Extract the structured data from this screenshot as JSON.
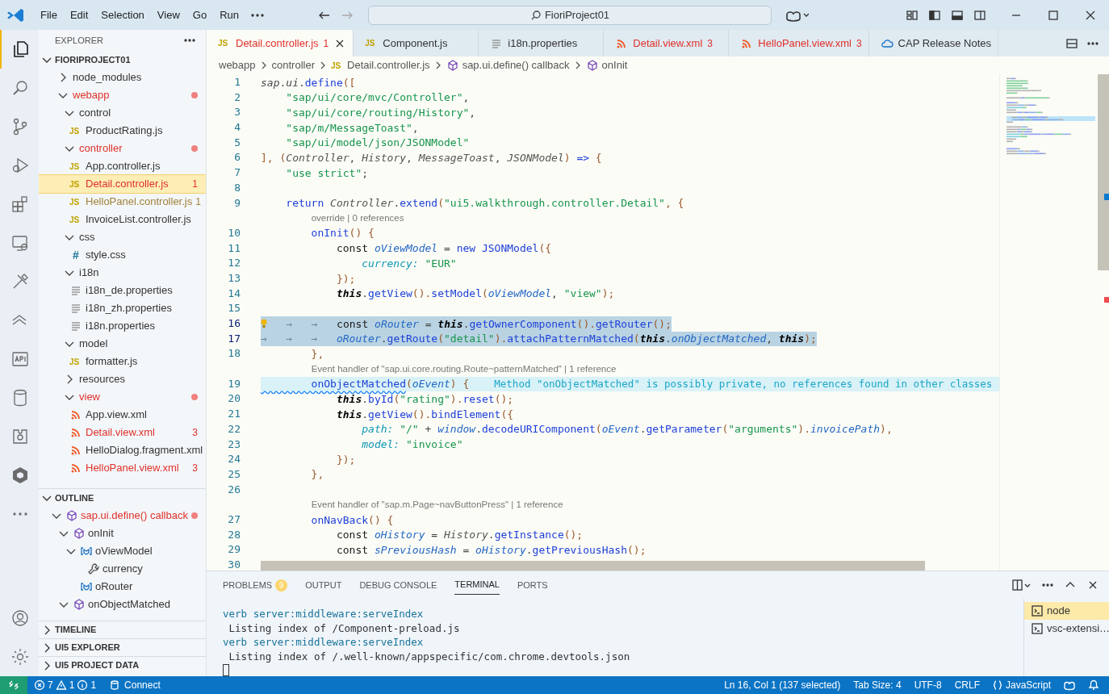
{
  "title_bar": {
    "menus": [
      "File",
      "Edit",
      "Selection",
      "View",
      "Go",
      "Run"
    ],
    "search": "FioriProject01"
  },
  "activity_bar": {
    "items": [
      {
        "kind": "files",
        "selected": true
      },
      {
        "kind": "search",
        "selected": false
      },
      {
        "kind": "source-control",
        "selected": false
      },
      {
        "kind": "debug",
        "selected": false
      },
      {
        "kind": "extensions",
        "selected": false
      },
      {
        "kind": "remote",
        "selected": false
      },
      {
        "kind": "tools",
        "selected": false
      },
      {
        "kind": "layers",
        "selected": false
      },
      {
        "kind": "api",
        "selected": false
      },
      {
        "kind": "database",
        "selected": false
      },
      {
        "kind": "puzzle",
        "selected": false
      },
      {
        "kind": "hexagon",
        "selected": false
      },
      {
        "kind": "more",
        "selected": false
      }
    ],
    "bottom": [
      {
        "kind": "account"
      },
      {
        "kind": "settings"
      }
    ]
  },
  "explorer": {
    "title": "EXPLORER",
    "root": "FIORIPROJECT01",
    "items": [
      {
        "label": "node_modules",
        "kind": "folder",
        "expanded": false,
        "error": false,
        "warning": false,
        "selected": false
      },
      {
        "label": "webapp",
        "kind": "folder",
        "expanded": true,
        "error": true,
        "warning": false,
        "selected": false,
        "children": [
          {
            "label": "control",
            "kind": "folder",
            "expanded": true,
            "error": false,
            "warning": false,
            "selected": false,
            "children": [
              {
                "label": "ProductRating.js",
                "kind": "js",
                "icon_text": "JS",
                "error": false,
                "warning": false,
                "selected": false
              }
            ]
          },
          {
            "label": "controller",
            "kind": "folder",
            "expanded": true,
            "error": true,
            "warning": false,
            "selected": false,
            "children": [
              {
                "label": "App.controller.js",
                "kind": "js",
                "icon_text": "JS",
                "error": false,
                "warning": false,
                "selected": false
              },
              {
                "label": "Detail.controller.js",
                "kind": "js",
                "icon_text": "JS",
                "error": true,
                "warning": false,
                "badge": "1",
                "selected": true
              },
              {
                "label": "HelloPanel.controller.js",
                "kind": "js",
                "icon_text": "JS",
                "error": false,
                "warning": true,
                "badge": "1",
                "selected": false
              },
              {
                "label": "InvoiceList.controller.js",
                "kind": "js",
                "icon_text": "JS",
                "error": false,
                "warning": false,
                "selected": false
              }
            ]
          },
          {
            "label": "css",
            "kind": "folder",
            "expanded": true,
            "error": false,
            "warning": false,
            "selected": false,
            "children": [
              {
                "label": "style.css",
                "kind": "css",
                "icon_text": "#",
                "error": false,
                "warning": false,
                "selected": false
              }
            ]
          },
          {
            "label": "i18n",
            "kind": "folder",
            "expanded": true,
            "error": false,
            "warning": false,
            "selected": false,
            "children": [
              {
                "label": "i18n_de.properties",
                "kind": "props",
                "error": false,
                "warning": false,
                "selected": false
              },
              {
                "label": "i18n_zh.properties",
                "kind": "props",
                "error": false,
                "warning": false,
                "selected": false
              },
              {
                "label": "i18n.properties",
                "kind": "props",
                "error": false,
                "warning": false,
                "selected": false
              }
            ]
          },
          {
            "label": "model",
            "kind": "folder",
            "expanded": true,
            "error": false,
            "warning": false,
            "selected": false,
            "children": [
              {
                "label": "formatter.js",
                "kind": "js",
                "icon_text": "JS",
                "error": false,
                "warning": false,
                "selected": false
              }
            ]
          },
          {
            "label": "resources",
            "kind": "folder",
            "expanded": false,
            "error": false,
            "warning": false,
            "selected": false
          },
          {
            "label": "view",
            "kind": "folder",
            "expanded": true,
            "error": true,
            "warning": false,
            "selected": false,
            "children": [
              {
                "label": "App.view.xml",
                "kind": "xml",
                "error": false,
                "warning": false,
                "selected": false
              },
              {
                "label": "Detail.view.xml",
                "kind": "xml",
                "error": true,
                "warning": false,
                "badge": "3",
                "selected": false
              },
              {
                "label": "HelloDialog.fragment.xml",
                "kind": "xml",
                "error": false,
                "warning": false,
                "selected": false
              },
              {
                "label": "HelloPanel.view.xml",
                "kind": "xml",
                "error": true,
                "warning": false,
                "badge": "3",
                "selected": false
              }
            ]
          }
        ]
      }
    ]
  },
  "outline": {
    "title": "OUTLINE",
    "items": [
      {
        "label": "sap.ui.define() callback",
        "kind": "method",
        "expanded": true,
        "error": true,
        "children": [
          {
            "label": "onInit",
            "kind": "method",
            "expanded": true,
            "error": false,
            "children": [
              {
                "label": "oViewModel",
                "kind": "variable",
                "expanded": true,
                "error": false,
                "children": [
                  {
                    "label": "currency",
                    "kind": "property",
                    "error": false
                  }
                ]
              },
              {
                "label": "oRouter",
                "kind": "variable",
                "error": false
              }
            ]
          },
          {
            "label": "onObjectMatched",
            "kind": "method",
            "expanded": true,
            "error": false
          }
        ]
      }
    ]
  },
  "collapsed_sections": [
    "TIMELINE",
    "UI5 EXPLORER",
    "UI5 PROJECT DATA"
  ],
  "tabs": [
    {
      "label": "Detail.controller.js",
      "kind": "js",
      "icon_text": "JS",
      "error": true,
      "badge": "1",
      "selected": true
    },
    {
      "label": "Component.js",
      "kind": "js",
      "icon_text": "JS",
      "error": false,
      "selected": false
    },
    {
      "label": "i18n.properties",
      "kind": "props",
      "error": false,
      "selected": false
    },
    {
      "label": "Detail.view.xml",
      "kind": "xml",
      "error": true,
      "badge": "3",
      "selected": false
    },
    {
      "label": "HelloPanel.view.xml",
      "kind": "xml",
      "error": true,
      "badge": "3",
      "selected": false
    },
    {
      "label": "CAP Release Notes",
      "kind": "cloud",
      "error": false,
      "selected": false
    }
  ],
  "breadcrumbs": [
    {
      "label": "webapp",
      "kind": "folder"
    },
    {
      "label": "controller",
      "kind": "folder"
    },
    {
      "label": "Detail.controller.js",
      "kind": "js",
      "icon_text": "JS"
    },
    {
      "label": "sap.ui.define() callback",
      "kind": "method"
    },
    {
      "label": "onInit",
      "kind": "method"
    }
  ],
  "editor": {
    "lines": [
      {
        "kind": "code",
        "number": "1",
        "selected": false,
        "highlighted": false,
        "tokens": [
          {
            "text": "sap",
            "kind": "id"
          },
          {
            "text": ".",
            "kind": "p"
          },
          {
            "text": "ui",
            "kind": "id"
          },
          {
            "text": ".",
            "kind": "p"
          },
          {
            "text": "define",
            "kind": "fn"
          },
          {
            "text": "([",
            "kind": "br"
          }
        ]
      },
      {
        "kind": "code",
        "number": "2",
        "selected": false,
        "highlighted": false,
        "tokens": [
          {
            "text": "    \"sap/ui/core/mvc/Controller\"",
            "kind": "str"
          },
          {
            "text": ",",
            "kind": "p"
          }
        ]
      },
      {
        "kind": "code",
        "number": "3",
        "selected": false,
        "highlighted": false,
        "tokens": [
          {
            "text": "    \"sap/ui/core/routing/History\"",
            "kind": "str"
          },
          {
            "text": ",",
            "kind": "p"
          }
        ]
      },
      {
        "kind": "code",
        "number": "4",
        "selected": false,
        "highlighted": false,
        "tokens": [
          {
            "text": "    \"sap/m/MessageToast\"",
            "kind": "str"
          },
          {
            "text": ",",
            "kind": "p"
          }
        ]
      },
      {
        "kind": "code",
        "number": "5",
        "selected": false,
        "highlighted": false,
        "tokens": [
          {
            "text": "    \"sap/ui/model/json/JSONModel\"",
            "kind": "str"
          }
        ]
      },
      {
        "kind": "code",
        "number": "6",
        "selected": false,
        "highlighted": false,
        "tokens": [
          {
            "text": "], (",
            "kind": "br"
          },
          {
            "text": "Controller",
            "kind": "cls"
          },
          {
            "text": ",",
            "kind": "p"
          },
          {
            "text": " History",
            "kind": "cls"
          },
          {
            "text": ",",
            "kind": "p"
          },
          {
            "text": " MessageToast",
            "kind": "cls"
          },
          {
            "text": ",",
            "kind": "p"
          },
          {
            "text": " JSONModel",
            "kind": "cls"
          },
          {
            "text": ")",
            "kind": "br"
          },
          {
            "text": " =>",
            "kind": "kwb"
          },
          {
            "text": " {",
            "kind": "br"
          }
        ]
      },
      {
        "kind": "code",
        "number": "7",
        "selected": false,
        "highlighted": false,
        "tokens": [
          {
            "text": "    \"use strict\"",
            "kind": "str"
          },
          {
            "text": ";",
            "kind": "p"
          }
        ]
      },
      {
        "kind": "code",
        "number": "8",
        "selected": false,
        "highlighted": false
      },
      {
        "kind": "code",
        "number": "9",
        "selected": false,
        "highlighted": false,
        "tokens": [
          {
            "text": "    return",
            "kind": "kwb"
          },
          {
            "text": " Controller",
            "kind": "cls"
          },
          {
            "text": ".",
            "kind": "p"
          },
          {
            "text": "extend",
            "kind": "fn"
          },
          {
            "text": "(",
            "kind": "br"
          },
          {
            "text": "\"ui5.walkthrough.controller.Detail\"",
            "kind": "str"
          },
          {
            "text": ", {",
            "kind": "br"
          }
        ]
      },
      {
        "kind": "lens",
        "text": "override | 0 references"
      },
      {
        "kind": "code",
        "number": "10",
        "selected": false,
        "highlighted": false,
        "tokens": [
          {
            "text": "        onInit",
            "kind": "fn"
          },
          {
            "text": "() {",
            "kind": "br"
          }
        ]
      },
      {
        "kind": "code",
        "number": "11",
        "selected": false,
        "highlighted": false,
        "tokens": [
          {
            "text": "            const",
            "kind": "kw"
          },
          {
            "text": " oViewModel",
            "kind": "var"
          },
          {
            "text": " =",
            "kind": "p"
          },
          {
            "text": " new",
            "kind": "kwb"
          },
          {
            "text": " JSONModel",
            "kind": "fn"
          },
          {
            "text": "({",
            "kind": "br"
          }
        ]
      },
      {
        "kind": "code",
        "number": "12",
        "selected": false,
        "highlighted": false,
        "tokens": [
          {
            "text": "                currency:",
            "kind": "prop"
          },
          {
            "text": " \"EUR\"",
            "kind": "str"
          }
        ]
      },
      {
        "kind": "code",
        "number": "13",
        "selected": false,
        "highlighted": false,
        "tokens": [
          {
            "text": "            });",
            "kind": "br"
          }
        ]
      },
      {
        "kind": "code",
        "number": "14",
        "selected": false,
        "highlighted": false,
        "tokens": [
          {
            "text": "            this",
            "kind": "this"
          },
          {
            "text": ".",
            "kind": "p"
          },
          {
            "text": "getView",
            "kind": "fn"
          },
          {
            "text": "().",
            "kind": "br"
          },
          {
            "text": "setModel",
            "kind": "fn"
          },
          {
            "text": "(",
            "kind": "br"
          },
          {
            "text": "oViewModel",
            "kind": "var"
          },
          {
            "text": ",",
            "kind": "p"
          },
          {
            "text": " \"view\"",
            "kind": "str"
          },
          {
            "text": ");",
            "kind": "br"
          }
        ]
      },
      {
        "kind": "code",
        "number": "15",
        "selected": false,
        "highlighted": false
      },
      {
        "kind": "code",
        "number": "16",
        "selected": true,
        "highlighted": false,
        "tokens": [
          {
            "kind": "bulb"
          },
          {
            "text": "   →   →",
            "kind": "ws"
          },
          {
            "text": "   const",
            "kind": "kw"
          },
          {
            "text": " oRouter",
            "kind": "var"
          },
          {
            "text": " =",
            "kind": "p"
          },
          {
            "text": " this",
            "kind": "this"
          },
          {
            "text": ".",
            "kind": "p"
          },
          {
            "text": "getOwnerComponent",
            "kind": "fn"
          },
          {
            "text": "().",
            "kind": "br"
          },
          {
            "text": "getRouter",
            "kind": "fn"
          },
          {
            "text": "();",
            "kind": "br"
          }
        ]
      },
      {
        "kind": "code",
        "number": "17",
        "selected": true,
        "highlighted": false,
        "tokens": [
          {
            "text": "→   →   →",
            "kind": "ws"
          },
          {
            "text": "   oRouter",
            "kind": "var"
          },
          {
            "text": ".",
            "kind": "p"
          },
          {
            "text": "getRoute",
            "kind": "fn"
          },
          {
            "text": "(",
            "kind": "br"
          },
          {
            "text": "\"detail\"",
            "kind": "str"
          },
          {
            "text": ").",
            "kind": "br"
          },
          {
            "text": "attachPatternMatched",
            "kind": "fn"
          },
          {
            "text": "(",
            "kind": "br"
          },
          {
            "text": "this",
            "kind": "this"
          },
          {
            "text": ".",
            "kind": "p"
          },
          {
            "text": "onObjectMatched",
            "kind": "var"
          },
          {
            "text": ",",
            "kind": "p"
          },
          {
            "text": " this",
            "kind": "this"
          },
          {
            "text": ");",
            "kind": "br"
          }
        ]
      },
      {
        "kind": "code",
        "number": "18",
        "selected": false,
        "highlighted": false,
        "tokens": [
          {
            "text": "        },",
            "kind": "br"
          }
        ]
      },
      {
        "kind": "lens",
        "text": "Event handler of \"sap.ui.core.routing.Route~patternMatched\" | 1 reference"
      },
      {
        "kind": "code",
        "number": "19",
        "selected": false,
        "highlighted": true,
        "hint": "Method \"onObjectMatched\" is possibly private, no references found in other classes",
        "tokens": [
          {
            "text": "        onObjectMatched",
            "kind": "fnwarn"
          },
          {
            "text": "(",
            "kind": "br"
          },
          {
            "text": "oEvent",
            "kind": "var"
          },
          {
            "text": ") {",
            "kind": "br"
          }
        ]
      },
      {
        "kind": "code",
        "number": "20",
        "selected": false,
        "highlighted": false,
        "tokens": [
          {
            "text": "            this",
            "kind": "this"
          },
          {
            "text": ".",
            "kind": "p"
          },
          {
            "text": "byId",
            "kind": "fn"
          },
          {
            "text": "(",
            "kind": "br"
          },
          {
            "text": "\"rating\"",
            "kind": "str"
          },
          {
            "text": ").",
            "kind": "br"
          },
          {
            "text": "reset",
            "kind": "fn"
          },
          {
            "text": "();",
            "kind": "br"
          }
        ]
      },
      {
        "kind": "code",
        "number": "21",
        "selected": false,
        "highlighted": false,
        "tokens": [
          {
            "text": "            this",
            "kind": "this"
          },
          {
            "text": ".",
            "kind": "p"
          },
          {
            "text": "getView",
            "kind": "fn"
          },
          {
            "text": "().",
            "kind": "br"
          },
          {
            "text": "bindElement",
            "kind": "fn"
          },
          {
            "text": "({",
            "kind": "br"
          }
        ]
      },
      {
        "kind": "code",
        "number": "22",
        "selected": false,
        "highlighted": false,
        "tokens": [
          {
            "text": "                path:",
            "kind": "prop"
          },
          {
            "text": " \"/\"",
            "kind": "str"
          },
          {
            "text": " +",
            "kind": "p"
          },
          {
            "text": " window",
            "kind": "var"
          },
          {
            "text": ".",
            "kind": "p"
          },
          {
            "text": "decodeURIComponent",
            "kind": "fn"
          },
          {
            "text": "(",
            "kind": "br"
          },
          {
            "text": "oEvent",
            "kind": "var"
          },
          {
            "text": ".",
            "kind": "p"
          },
          {
            "text": "getParameter",
            "kind": "fn"
          },
          {
            "text": "(",
            "kind": "br"
          },
          {
            "text": "\"arguments\"",
            "kind": "str"
          },
          {
            "text": ").",
            "kind": "br"
          },
          {
            "text": "invoicePath",
            "kind": "var"
          },
          {
            "text": "),",
            "kind": "br"
          }
        ]
      },
      {
        "kind": "code",
        "number": "23",
        "selected": false,
        "highlighted": false,
        "tokens": [
          {
            "text": "                model:",
            "kind": "prop"
          },
          {
            "text": " \"invoice\"",
            "kind": "str"
          }
        ]
      },
      {
        "kind": "code",
        "number": "24",
        "selected": false,
        "highlighted": false,
        "tokens": [
          {
            "text": "            });",
            "kind": "br"
          }
        ]
      },
      {
        "kind": "code",
        "number": "25",
        "selected": false,
        "highlighted": false,
        "tokens": [
          {
            "text": "        },",
            "kind": "br"
          }
        ]
      },
      {
        "kind": "code",
        "number": "26",
        "selected": false,
        "highlighted": false
      },
      {
        "kind": "lens",
        "text": "Event handler of \"sap.m.Page~navButtonPress\" | 1 reference"
      },
      {
        "kind": "code",
        "number": "27",
        "selected": false,
        "highlighted": false,
        "tokens": [
          {
            "text": "        onNavBack",
            "kind": "fn"
          },
          {
            "text": "() {",
            "kind": "br"
          }
        ]
      },
      {
        "kind": "code",
        "number": "28",
        "selected": false,
        "highlighted": false,
        "tokens": [
          {
            "text": "            const",
            "kind": "kw"
          },
          {
            "text": " oHistory",
            "kind": "var"
          },
          {
            "text": " =",
            "kind": "p"
          },
          {
            "text": " History",
            "kind": "cls"
          },
          {
            "text": ".",
            "kind": "p"
          },
          {
            "text": "getInstance",
            "kind": "fn"
          },
          {
            "text": "();",
            "kind": "br"
          }
        ]
      },
      {
        "kind": "code",
        "number": "29",
        "selected": false,
        "highlighted": false,
        "tokens": [
          {
            "text": "            const",
            "kind": "kw"
          },
          {
            "text": " sPreviousHash",
            "kind": "var"
          },
          {
            "text": " =",
            "kind": "p"
          },
          {
            "text": " oHistory",
            "kind": "var"
          },
          {
            "text": ".",
            "kind": "p"
          },
          {
            "text": "getPreviousHash",
            "kind": "fn"
          },
          {
            "text": "();",
            "kind": "br"
          }
        ]
      },
      {
        "kind": "code",
        "number": "30",
        "selected": false,
        "highlighted": false
      }
    ]
  },
  "panel": {
    "tabs": [
      {
        "label": "PROBLEMS",
        "count": "9",
        "selected": false
      },
      {
        "label": "OUTPUT",
        "selected": false
      },
      {
        "label": "DEBUG CONSOLE",
        "selected": false
      },
      {
        "label": "TERMINAL",
        "selected": true
      },
      {
        "label": "PORTS",
        "selected": false
      }
    ],
    "terminal": [
      {
        "text": "verb server:middleware:serveIndex",
        "kind": "verb"
      },
      {
        "text": " Listing index of /Component-preload.js",
        "kind": "log"
      },
      {
        "text": "verb server:middleware:serveIndex",
        "kind": "verb"
      },
      {
        "text": " Listing index of /.well-known/appspecific/com.chrome.devtools.json",
        "kind": "log"
      }
    ],
    "terminals": [
      {
        "label": "node",
        "selected": true
      },
      {
        "label": "vsc-extensi…",
        "selected": false
      }
    ]
  },
  "status_bar": {
    "errors": "7",
    "warnings": "1",
    "infos": "1",
    "connect": "Connect",
    "items": [
      {
        "text": "Ln 16, Col 1 (137 selected)",
        "kind": "text"
      },
      {
        "text": "Tab Size: 4",
        "kind": "text"
      },
      {
        "text": "UTF-8",
        "kind": "text"
      },
      {
        "text": "CRLF",
        "kind": "text"
      },
      {
        "text": "JavaScript",
        "kind": "language"
      }
    ]
  }
}
